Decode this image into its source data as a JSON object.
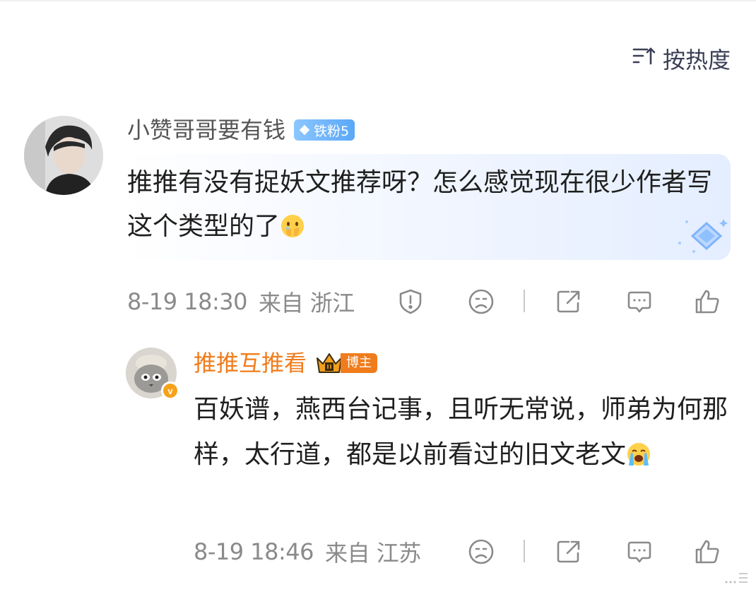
{
  "sort": {
    "label": "按热度",
    "icon": "sort-descending-icon"
  },
  "comment": {
    "username": "小赞哥哥要有钱",
    "fan_badge": "铁粉5",
    "text": "推推有没有捉妖文推荐呀？怎么感觉现在很少作者写这个类型的了",
    "emoji": "teary-hands-emoji",
    "time": "8-19 18:30",
    "location": "来自 浙江",
    "actions": [
      "report-icon",
      "dislike-face-icon",
      "share-icon",
      "reply-icon",
      "like-icon"
    ]
  },
  "reply": {
    "username": "推推互推看",
    "badge_label": "博主",
    "text": "百妖谱，燕西台记事，且听无常说，师弟为何那样，太行道，都是以前看过的旧文老文",
    "emoji": "crying-emoji",
    "verified_mark": "v",
    "time": "8-19 18:46",
    "location": "来自 江苏",
    "actions": [
      "dislike-face-icon",
      "share-icon",
      "reply-icon",
      "like-icon"
    ]
  },
  "colors": {
    "username_orange": "#f07c1c",
    "meta_gray": "#8a8a8a",
    "fan_badge_blue": "#5aa8f6",
    "bubble_blue": "#e4eeff"
  }
}
